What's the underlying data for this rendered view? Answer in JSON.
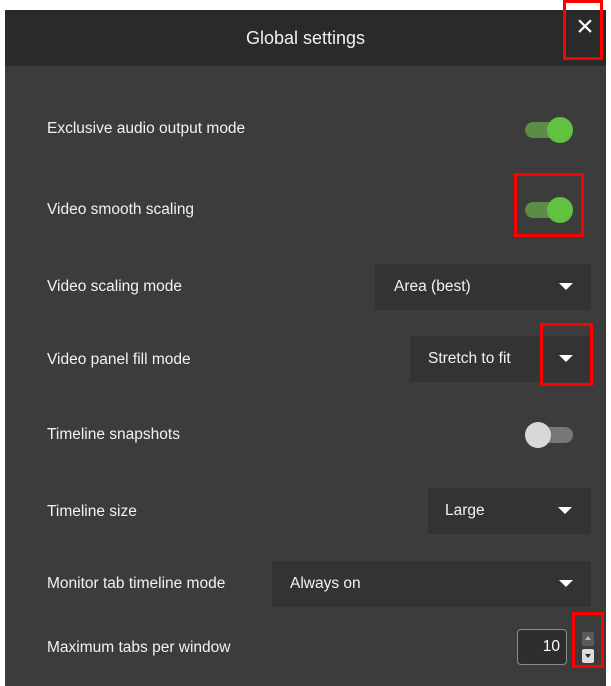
{
  "dialog": {
    "title": "Global settings",
    "close_icon": "×"
  },
  "settings": {
    "exclusive_audio": {
      "label": "Exclusive audio output mode",
      "on": true
    },
    "video_smooth": {
      "label": "Video smooth scaling",
      "on": true
    },
    "video_scaling_mode": {
      "label": "Video scaling mode",
      "value": "Area (best)"
    },
    "video_panel_fill": {
      "label": "Video panel fill mode",
      "value": "Stretch to fit"
    },
    "timeline_snapshots": {
      "label": "Timeline snapshots",
      "on": false
    },
    "timeline_size": {
      "label": "Timeline size",
      "value": "Large"
    },
    "monitor_timeline": {
      "label": "Monitor tab timeline mode",
      "value": "Always on"
    },
    "max_tabs": {
      "label": "Maximum tabs per window",
      "value": "10"
    }
  },
  "colors": {
    "panel_bg": "#3c3c3c",
    "titlebar_bg": "#2a2a2a",
    "toggle_on": "#62c23f",
    "highlight": "#ff0000"
  }
}
